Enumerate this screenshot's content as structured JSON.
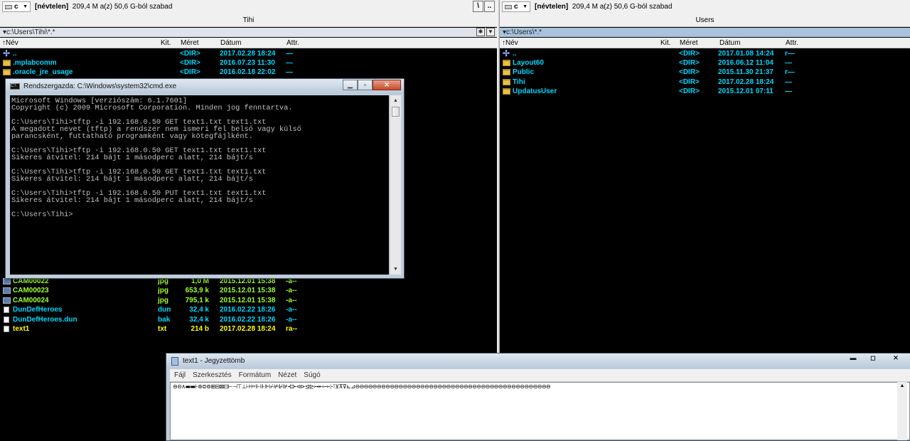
{
  "left_panel": {
    "drive": "c",
    "volume": "[névtelen]",
    "space": "209,4 M a(z) 50,6 G-ból szabad",
    "root_button": "\\",
    "parent_button": "..",
    "title": "Tihi",
    "path": "c:\\Users\\Tihi\\*.*",
    "columns": {
      "name": "Név",
      "ext": "Kit.",
      "size": "Méret",
      "date": "Dátum",
      "attr": "Attr."
    },
    "top_rows": [
      {
        "icon": "up",
        "name": "..",
        "ext": "",
        "size": "<DIR>",
        "date": "2017.02.28 18:24",
        "attr": "—",
        "color": "cyan"
      },
      {
        "icon": "folder",
        "name": ".mplabcomm",
        "ext": "",
        "size": "<DIR>",
        "date": "2016.07.23 11:30",
        "attr": "—",
        "color": "cyan"
      },
      {
        "icon": "folder",
        "name": ".oracle_jre_usage",
        "ext": "",
        "size": "<DIR>",
        "date": "2016.02.18 22:02",
        "attr": "—",
        "color": "cyan"
      }
    ],
    "bottom_rows": [
      {
        "icon": "img",
        "name": "CAM00022",
        "ext": "jpg",
        "size": "1,0 M",
        "date": "2015.12.01 15:38",
        "attr": "-a--",
        "color": "green"
      },
      {
        "icon": "img",
        "name": "CAM00023",
        "ext": "jpg",
        "size": "653,9 k",
        "date": "2015.12.01 15:38",
        "attr": "-a--",
        "color": "green"
      },
      {
        "icon": "img",
        "name": "CAM00024",
        "ext": "jpg",
        "size": "795,1 k",
        "date": "2015.12.01 15:38",
        "attr": "-a--",
        "color": "green"
      },
      {
        "icon": "file",
        "name": "DunDefHeroes",
        "ext": "dun",
        "size": "32,4 k",
        "date": "2016.02.22 18:26",
        "attr": "-a--",
        "color": "cyan"
      },
      {
        "icon": "file",
        "name": "DunDefHeroes.dun",
        "ext": "bak",
        "size": "32,4 k",
        "date": "2016.02.22 18:26",
        "attr": "-a--",
        "color": "cyan"
      },
      {
        "icon": "txt",
        "name": "text1",
        "ext": "txt",
        "size": "214 b",
        "date": "2017.02.28 18:24",
        "attr": "ra--",
        "color": "yellow"
      }
    ]
  },
  "right_panel": {
    "drive": "c",
    "volume": "[névtelen]",
    "space": "209,4 M a(z) 50,6 G-ból szabad",
    "title": "Users",
    "path": "c:\\Users\\*.*",
    "columns": {
      "name": "Név",
      "ext": "Kit.",
      "size": "Méret",
      "date": "Dátum",
      "attr": "Attr."
    },
    "rows": [
      {
        "icon": "up",
        "name": "..",
        "size": "<DIR>",
        "date": "2017.01.08 14:24",
        "attr": "r—"
      },
      {
        "icon": "folder",
        "name": "Layout60",
        "size": "<DIR>",
        "date": "2016.06.12 11:04",
        "attr": "—"
      },
      {
        "icon": "folder",
        "name": "Public",
        "size": "<DIR>",
        "date": "2015.11.30 21:37",
        "attr": "r—"
      },
      {
        "icon": "folder",
        "name": "Tihi",
        "size": "<DIR>",
        "date": "2017.02.28 18:24",
        "attr": "—"
      },
      {
        "icon": "folder",
        "name": "UpdatusUser",
        "size": "<DIR>",
        "date": "2015.12.01 07:11",
        "attr": "—"
      }
    ]
  },
  "cmd": {
    "title": "Rendszergazda: C:\\Windows\\system32\\cmd.exe",
    "icon": "cmd-icon",
    "lines": [
      "Microsoft Windows [verziószám: 6.1.7601]",
      "Copyright (c) 2009 Microsoft Corporation. Minden jog fenntartva.",
      "",
      "C:\\Users\\Tihi>tftp -i 192.168.0.50 GET text1.txt text1.txt",
      "A megadott nevet (tftp) a rendszer nem ismeri fel belső vagy külső",
      "parancsként, futtatható programként vagy kötegfájlként.",
      "",
      "C:\\Users\\Tihi>tftp -i 192.168.0.50 GET text1.txt text1.txt",
      "Sikeres átvitel: 214 bájt 1 másodperc alatt, 214 bájt/s",
      "",
      "C:\\Users\\Tihi>tftp -i 192.168.0.50 GET text1.txt text1.txt",
      "Sikeres átvitel: 214 bájt 1 másodperc alatt, 214 bájt/s",
      "",
      "C:\\Users\\Tihi>tftp -i 192.168.0.50 PUT text1.txt text1.txt",
      "Sikeres átvitel: 214 bájt 1 másodperc alatt, 214 bájt/s",
      "",
      "C:\\Users\\Tihi>"
    ]
  },
  "notepad": {
    "title": "text1 - Jegyzettömb",
    "menu": [
      "Fájl",
      "Szerkesztés",
      "Formátum",
      "Nézet",
      "Súgó"
    ],
    "content": "⊖⊝∧▬▬⊦⊛⊜⊚⊞⊟⊠⊡⊢⊣⊤⊥⊦⊧⊨⊩⊪⊫⊬⊭⊮⊯⊰⊱⊲⊳⊴⊵⊶⊷⊸⊹⊺⊻⊼⊽⊾⊿⊖⊖⊖⊖⊖⊖⊖⊖⊖⊖⊖⊖⊖⊖⊖⊖⊖⊖⊖⊖⊖⊖⊖⊖⊖⊖⊖⊖⊖⊖⊖⊖⊖⊖⊖⊖⊖⊖⊖⊖⊖⊖⊖⊖⊖"
  },
  "colors": {
    "panel_bg": "#000000",
    "dir_text": "#00d8ff",
    "jpg_text": "#a0ff30",
    "txt_text": "#ffff00"
  }
}
